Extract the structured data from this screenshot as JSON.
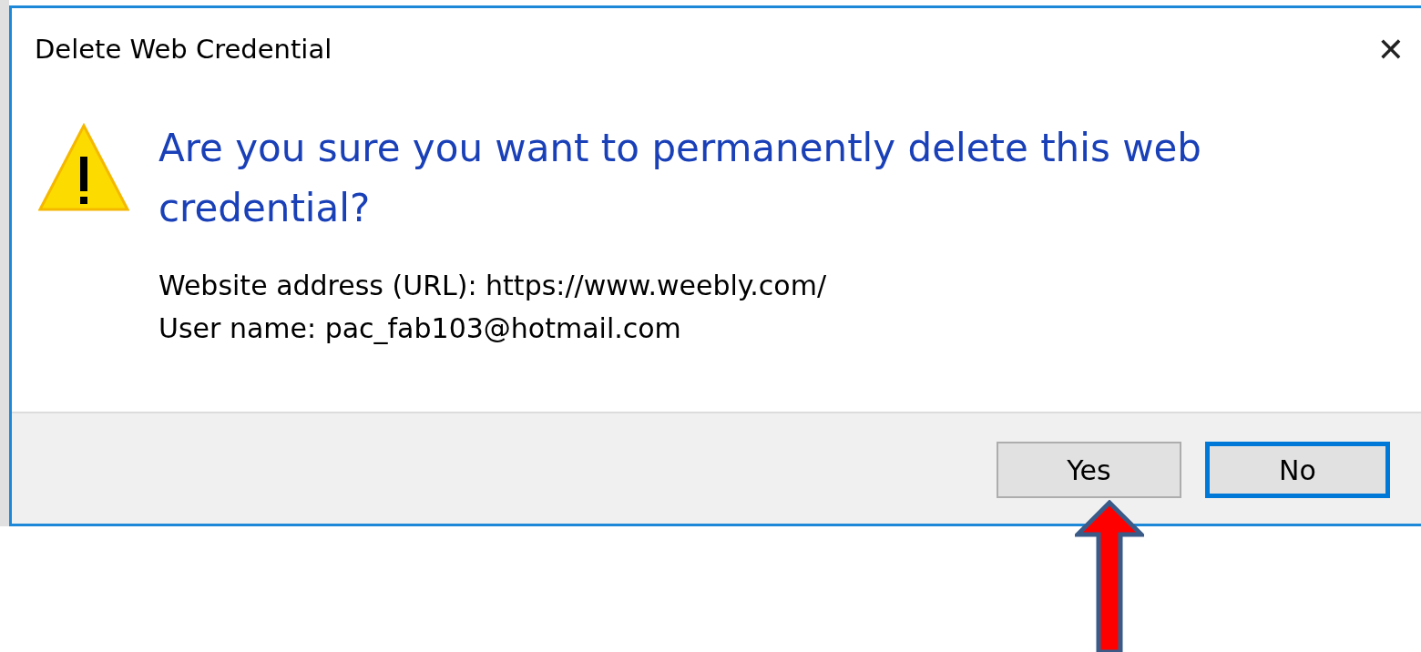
{
  "window": {
    "title": "Delete Web Credential",
    "close": "✕"
  },
  "message": {
    "heading": "Are you sure you want to permanently delete this web credential?",
    "details": [
      "Website address (URL): https://www.weebly.com/",
      "User name: pac_fab103@hotmail.com"
    ]
  },
  "buttons": [
    {
      "label": "Yes",
      "default": false,
      "annotated": true
    },
    {
      "label": "No",
      "default": true,
      "annotated": false
    }
  ]
}
